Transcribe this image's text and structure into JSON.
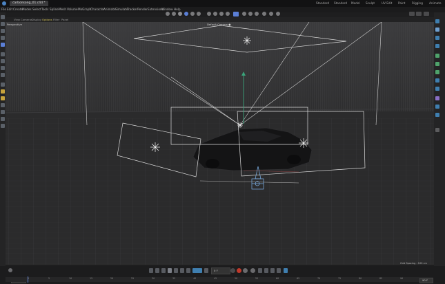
{
  "title_bar": {
    "document_tab": "carbonsong_01.c4d *",
    "layout_tabs": [
      "Standard",
      "Standard",
      "Model",
      "Sculpt",
      "UV Edit",
      "Paint",
      "Rigging",
      "Animate"
    ]
  },
  "menu": {
    "items": [
      "File",
      "Edit",
      "Create",
      "Modes",
      "Select",
      "Tools",
      "Spline",
      "Mesh",
      "Volume",
      "MoGraph",
      "Character",
      "Animate",
      "Simulate",
      "Tracker",
      "Render",
      "Extensions",
      "Window",
      "Help"
    ]
  },
  "viewport": {
    "menu": [
      "View",
      "Cameras",
      "Display",
      "Options",
      "Filter",
      "Panel"
    ],
    "projection_label": "Perspective",
    "camera_label": "Default Camera ●",
    "grid_spacing": "Grid Spacing : 100 cm"
  },
  "timeline": {
    "current_frame": "0 F",
    "start_field": "0 F",
    "end_field": "90 F",
    "ruler_ticks": [
      "0",
      "5",
      "10",
      "15",
      "20",
      "25",
      "30",
      "35",
      "40",
      "45",
      "50",
      "55",
      "60",
      "65",
      "70",
      "75",
      "80",
      "85",
      "90"
    ]
  },
  "colors": {
    "accent": "#3f7fb0",
    "record": "#c0392b",
    "gizmo_y": "#3aa37a",
    "playhead": "#5b7fd6"
  }
}
